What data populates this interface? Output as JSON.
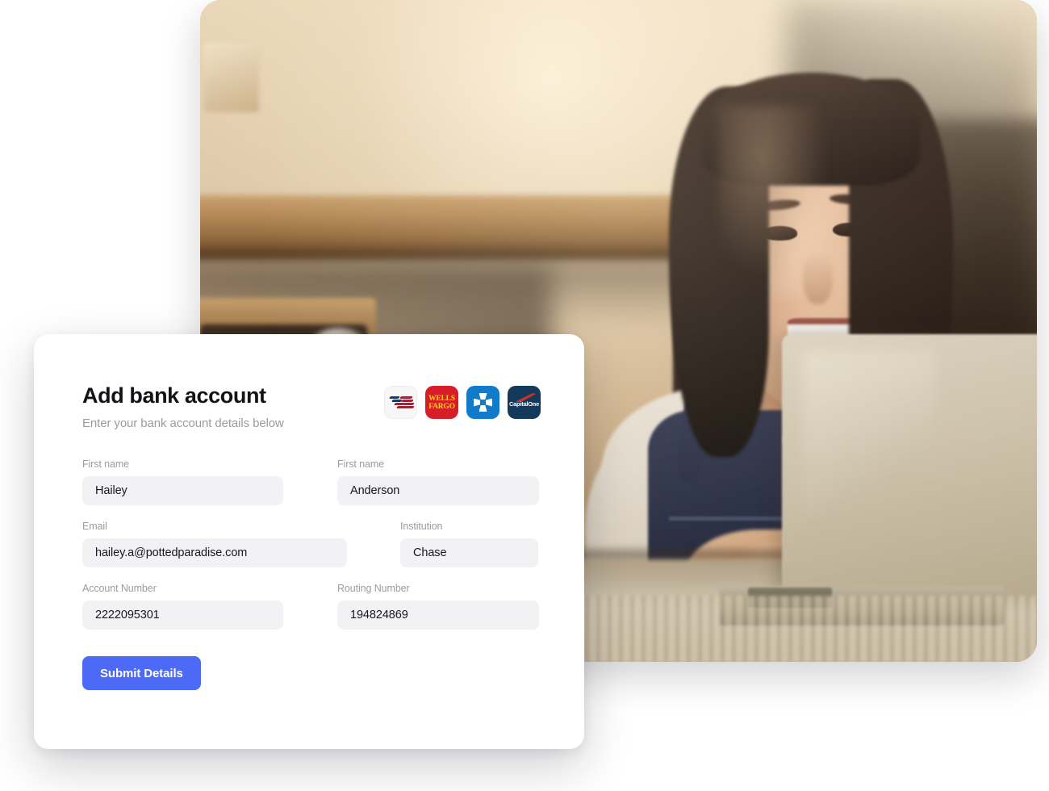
{
  "card": {
    "title": "Add bank account",
    "subtitle": "Enter your bank account details below",
    "submit_label": "Submit Details",
    "accent_color": "#4c6af5",
    "input_bg": "#f2f2f4",
    "label_color": "#9b9ba1"
  },
  "banks": [
    {
      "name": "bank-of-america",
      "label": "",
      "bg": "#f7f7f8"
    },
    {
      "name": "wells-fargo",
      "label_line1": "WELLS",
      "label_line2": "FARGO",
      "bg": "#d71e28",
      "fg": "#ffd400"
    },
    {
      "name": "chase",
      "label": "",
      "bg": "#117ac9"
    },
    {
      "name": "capital-one",
      "label": "CapitalOne",
      "bg": "#13395b",
      "accent": "#d03027"
    }
  ],
  "form": {
    "rows": [
      {
        "left": {
          "label": "First name",
          "value": "Hailey",
          "placeholder": "First name"
        },
        "right": {
          "label": "First name",
          "value": "Anderson",
          "placeholder": "First name"
        }
      },
      {
        "left": {
          "label": "Email",
          "value": "hailey.a@pottedparadise.com",
          "placeholder": "Email"
        },
        "right": {
          "label": "Institution",
          "value": "Chase",
          "placeholder": "Institution"
        }
      },
      {
        "left": {
          "label": "Account Number",
          "value": "2222095301",
          "placeholder": "Account Number"
        },
        "right": {
          "label": "Routing Number",
          "value": "194824869",
          "placeholder": "Routing Number"
        }
      }
    ]
  }
}
